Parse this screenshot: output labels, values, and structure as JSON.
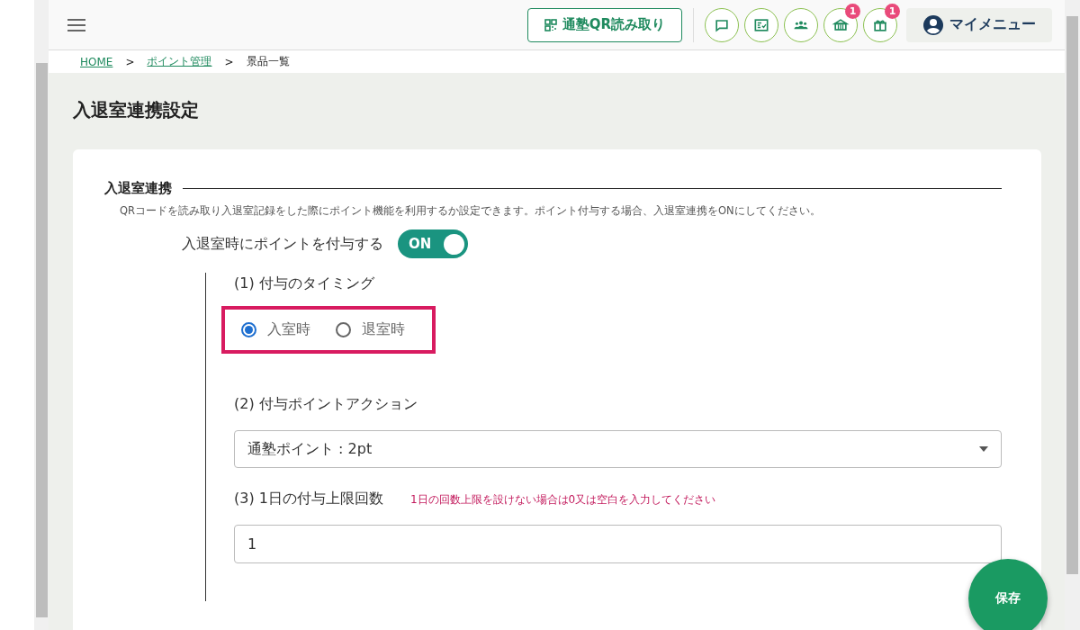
{
  "header": {
    "qr_button": "通塾QR読み取り",
    "icon_buttons": [
      {
        "kind": "chat"
      },
      {
        "kind": "checklist"
      },
      {
        "kind": "group"
      },
      {
        "kind": "shop",
        "badge": "1"
      },
      {
        "kind": "gift",
        "badge": "1"
      }
    ],
    "my_menu": "マイメニュー"
  },
  "breadcrumb": [
    {
      "kind": "link",
      "label": "HOME"
    },
    {
      "kind": "separator",
      "label": ">"
    },
    {
      "kind": "link",
      "label": "ポイント管理"
    },
    {
      "kind": "separator",
      "label": ">"
    },
    {
      "kind": "current",
      "label": "景品一覧"
    }
  ],
  "page_title": "入退室連携設定",
  "section": {
    "title": "入退室連携",
    "description": "QRコードを読み取り入退室記録をした際にポイント機能を利用するか設定できます。ポイント付与する場合、入退室連携をONにしてください。",
    "toggle": {
      "label": "入退室時にポイントを付与する",
      "on": true,
      "text": "ON"
    },
    "timing": {
      "label": "(1) 付与のタイミング",
      "highlighted": true,
      "options": [
        {
          "label": "入室時",
          "selected": true
        },
        {
          "label": "退室時",
          "selected": false
        }
      ]
    },
    "action": {
      "label": "(2) 付与ポイントアクション",
      "value": "通塾ポイント : 2pt"
    },
    "limit": {
      "label": "(3) 1日の付与上限回数",
      "hint": "1日の回数上限を設けない場合は0又は空白を入力してください",
      "value": "1"
    }
  },
  "save_button": "保存"
}
